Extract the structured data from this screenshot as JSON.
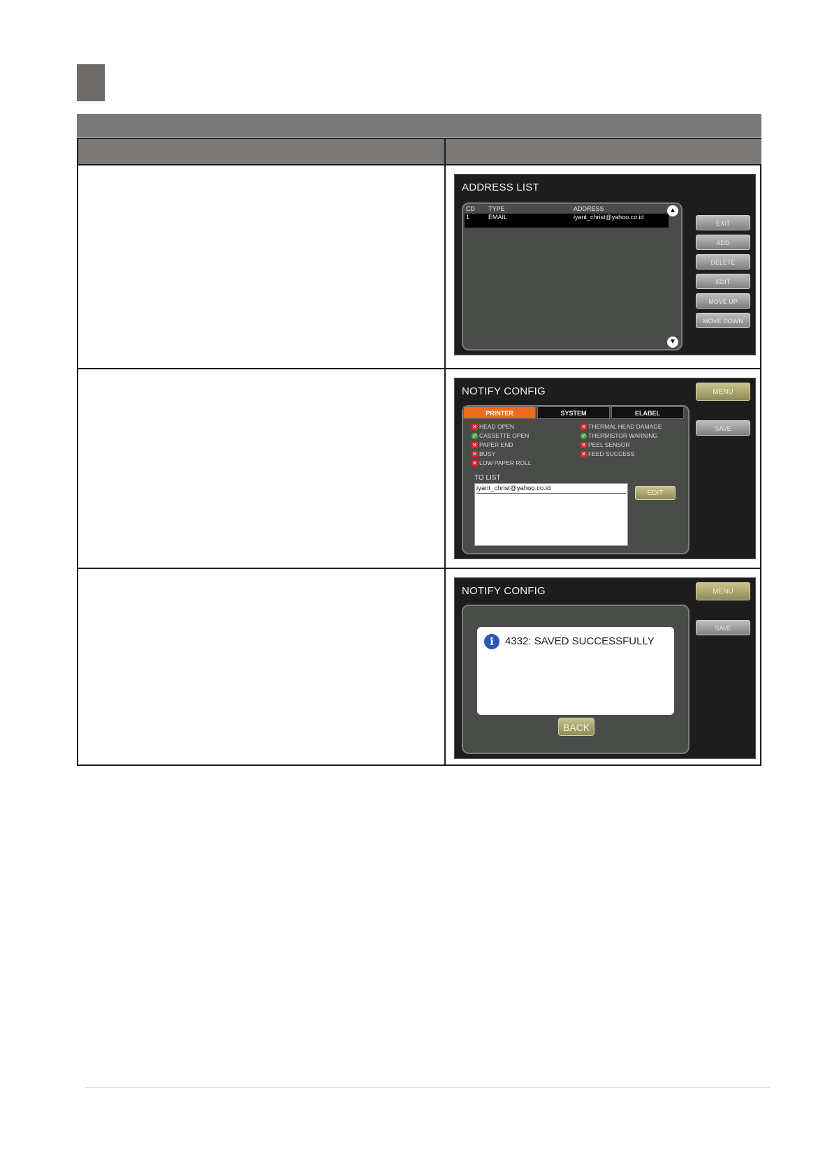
{
  "screen1": {
    "title": "ADDRESS LIST",
    "columns": [
      "CD",
      "TYPE",
      "ADDRESS"
    ],
    "row": {
      "cd": "1",
      "type": "EMAIL",
      "address": "iyant_christ@yahoo.co.id"
    },
    "scroll_up": "▲",
    "scroll_down": "▼",
    "buttons": [
      "EXIT",
      "ADD",
      "DELETE",
      "EDIT",
      "MOVE UP",
      "MOVE DOWN"
    ]
  },
  "screen2": {
    "title": "NOTIFY CONFIG",
    "menu": "MENU",
    "save": "SAVE",
    "tabs": [
      "PRINTER",
      "SYSTEM",
      "ELABEL"
    ],
    "options_left": [
      "HEAD OPEN",
      "CASSETTE OPEN",
      "PAPER END",
      "BUSY",
      "LOW PAPER ROLL"
    ],
    "options_right": [
      "THERMAL HEAD DAMAGE",
      "THERMISTOR WARNING",
      "PEEL SENSOR",
      "FEED SUCCESS"
    ],
    "to_list_label": "TO LIST",
    "to_list_item": "iyant_christ@yahoo.co.id",
    "edit": "EDIT"
  },
  "screen3": {
    "title": "NOTIFY CONFIG",
    "menu": "MENU",
    "save": "SAVE",
    "info_glyph": "i",
    "message": "4332: SAVED SUCCESSFULLY",
    "back": "BACK"
  }
}
